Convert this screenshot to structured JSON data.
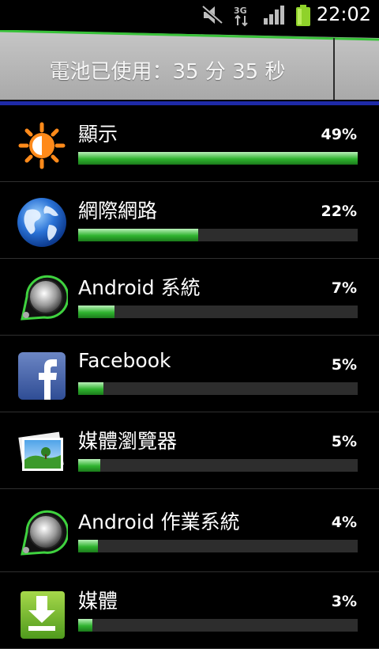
{
  "status_bar": {
    "time": "22:02",
    "icons": [
      "mute-icon",
      "3g-data-icon",
      "signal-strength-icon",
      "battery-icon"
    ]
  },
  "header": {
    "battery_usage_text": "電池已使用：35 分 35 秒"
  },
  "colors": {
    "bar_green": "#2fb32f",
    "accent_blue": "#1e2aa8",
    "header_gray": "#b8b8b8"
  },
  "usage_list": [
    {
      "label": "顯示",
      "percent": "49%",
      "fraction": 1.0,
      "icon": "brightness-sun-icon"
    },
    {
      "label": "網際網路",
      "percent": "22%",
      "fraction": 0.43,
      "icon": "globe-icon"
    },
    {
      "label": "Android 系統",
      "percent": "7%",
      "fraction": 0.13,
      "icon": "android-system-icon"
    },
    {
      "label": "Facebook",
      "percent": "5%",
      "fraction": 0.09,
      "icon": "facebook-icon"
    },
    {
      "label": "媒體瀏覽器",
      "percent": "5%",
      "fraction": 0.08,
      "icon": "gallery-icon"
    },
    {
      "label": "Android 作業系統",
      "percent": "4%",
      "fraction": 0.07,
      "icon": "android-os-icon"
    },
    {
      "label": "媒體",
      "percent": "3%",
      "fraction": 0.05,
      "icon": "download-icon"
    }
  ]
}
